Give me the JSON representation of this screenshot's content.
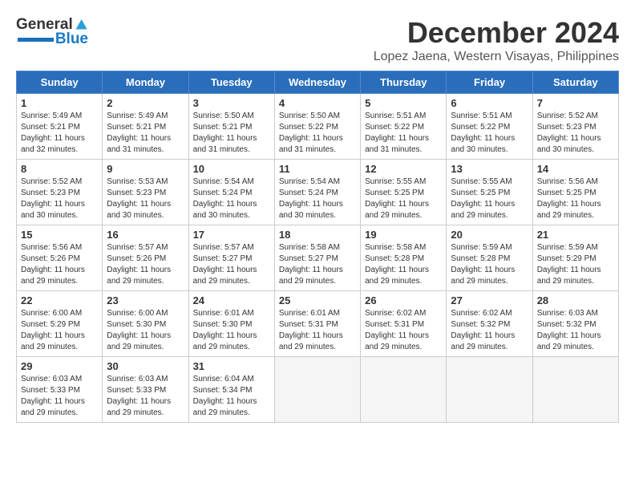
{
  "logo": {
    "part1": "General",
    "part2": "Blue"
  },
  "title": {
    "month_year": "December 2024",
    "location": "Lopez Jaena, Western Visayas, Philippines"
  },
  "days_of_week": [
    "Sunday",
    "Monday",
    "Tuesday",
    "Wednesday",
    "Thursday",
    "Friday",
    "Saturday"
  ],
  "weeks": [
    [
      {
        "day": "1",
        "info": "Sunrise: 5:49 AM\nSunset: 5:21 PM\nDaylight: 11 hours\nand 32 minutes."
      },
      {
        "day": "2",
        "info": "Sunrise: 5:49 AM\nSunset: 5:21 PM\nDaylight: 11 hours\nand 31 minutes."
      },
      {
        "day": "3",
        "info": "Sunrise: 5:50 AM\nSunset: 5:21 PM\nDaylight: 11 hours\nand 31 minutes."
      },
      {
        "day": "4",
        "info": "Sunrise: 5:50 AM\nSunset: 5:22 PM\nDaylight: 11 hours\nand 31 minutes."
      },
      {
        "day": "5",
        "info": "Sunrise: 5:51 AM\nSunset: 5:22 PM\nDaylight: 11 hours\nand 31 minutes."
      },
      {
        "day": "6",
        "info": "Sunrise: 5:51 AM\nSunset: 5:22 PM\nDaylight: 11 hours\nand 30 minutes."
      },
      {
        "day": "7",
        "info": "Sunrise: 5:52 AM\nSunset: 5:23 PM\nDaylight: 11 hours\nand 30 minutes."
      }
    ],
    [
      {
        "day": "8",
        "info": "Sunrise: 5:52 AM\nSunset: 5:23 PM\nDaylight: 11 hours\nand 30 minutes."
      },
      {
        "day": "9",
        "info": "Sunrise: 5:53 AM\nSunset: 5:23 PM\nDaylight: 11 hours\nand 30 minutes."
      },
      {
        "day": "10",
        "info": "Sunrise: 5:54 AM\nSunset: 5:24 PM\nDaylight: 11 hours\nand 30 minutes."
      },
      {
        "day": "11",
        "info": "Sunrise: 5:54 AM\nSunset: 5:24 PM\nDaylight: 11 hours\nand 30 minutes."
      },
      {
        "day": "12",
        "info": "Sunrise: 5:55 AM\nSunset: 5:25 PM\nDaylight: 11 hours\nand 29 minutes."
      },
      {
        "day": "13",
        "info": "Sunrise: 5:55 AM\nSunset: 5:25 PM\nDaylight: 11 hours\nand 29 minutes."
      },
      {
        "day": "14",
        "info": "Sunrise: 5:56 AM\nSunset: 5:25 PM\nDaylight: 11 hours\nand 29 minutes."
      }
    ],
    [
      {
        "day": "15",
        "info": "Sunrise: 5:56 AM\nSunset: 5:26 PM\nDaylight: 11 hours\nand 29 minutes."
      },
      {
        "day": "16",
        "info": "Sunrise: 5:57 AM\nSunset: 5:26 PM\nDaylight: 11 hours\nand 29 minutes."
      },
      {
        "day": "17",
        "info": "Sunrise: 5:57 AM\nSunset: 5:27 PM\nDaylight: 11 hours\nand 29 minutes."
      },
      {
        "day": "18",
        "info": "Sunrise: 5:58 AM\nSunset: 5:27 PM\nDaylight: 11 hours\nand 29 minutes."
      },
      {
        "day": "19",
        "info": "Sunrise: 5:58 AM\nSunset: 5:28 PM\nDaylight: 11 hours\nand 29 minutes."
      },
      {
        "day": "20",
        "info": "Sunrise: 5:59 AM\nSunset: 5:28 PM\nDaylight: 11 hours\nand 29 minutes."
      },
      {
        "day": "21",
        "info": "Sunrise: 5:59 AM\nSunset: 5:29 PM\nDaylight: 11 hours\nand 29 minutes."
      }
    ],
    [
      {
        "day": "22",
        "info": "Sunrise: 6:00 AM\nSunset: 5:29 PM\nDaylight: 11 hours\nand 29 minutes."
      },
      {
        "day": "23",
        "info": "Sunrise: 6:00 AM\nSunset: 5:30 PM\nDaylight: 11 hours\nand 29 minutes."
      },
      {
        "day": "24",
        "info": "Sunrise: 6:01 AM\nSunset: 5:30 PM\nDaylight: 11 hours\nand 29 minutes."
      },
      {
        "day": "25",
        "info": "Sunrise: 6:01 AM\nSunset: 5:31 PM\nDaylight: 11 hours\nand 29 minutes."
      },
      {
        "day": "26",
        "info": "Sunrise: 6:02 AM\nSunset: 5:31 PM\nDaylight: 11 hours\nand 29 minutes."
      },
      {
        "day": "27",
        "info": "Sunrise: 6:02 AM\nSunset: 5:32 PM\nDaylight: 11 hours\nand 29 minutes."
      },
      {
        "day": "28",
        "info": "Sunrise: 6:03 AM\nSunset: 5:32 PM\nDaylight: 11 hours\nand 29 minutes."
      }
    ],
    [
      {
        "day": "29",
        "info": "Sunrise: 6:03 AM\nSunset: 5:33 PM\nDaylight: 11 hours\nand 29 minutes."
      },
      {
        "day": "30",
        "info": "Sunrise: 6:03 AM\nSunset: 5:33 PM\nDaylight: 11 hours\nand 29 minutes."
      },
      {
        "day": "31",
        "info": "Sunrise: 6:04 AM\nSunset: 5:34 PM\nDaylight: 11 hours\nand 29 minutes."
      },
      {
        "day": "",
        "info": ""
      },
      {
        "day": "",
        "info": ""
      },
      {
        "day": "",
        "info": ""
      },
      {
        "day": "",
        "info": ""
      }
    ]
  ]
}
